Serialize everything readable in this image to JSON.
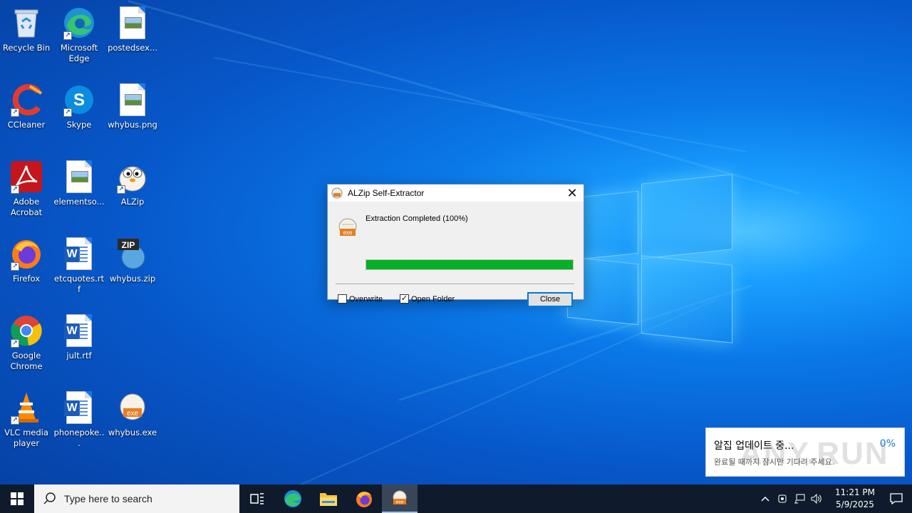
{
  "desktop": {
    "icons": [
      {
        "label": "Recycle Bin"
      },
      {
        "label": "Microsoft Edge"
      },
      {
        "label": "postedsex..."
      },
      {
        "label": "CCleaner"
      },
      {
        "label": "Skype"
      },
      {
        "label": "whybus.png"
      },
      {
        "label": "Adobe Acrobat"
      },
      {
        "label": "elementso..."
      },
      {
        "label": "ALZip"
      },
      {
        "label": "Firefox"
      },
      {
        "label": "etcquotes.rtf"
      },
      {
        "label": "whybus.zip"
      },
      {
        "label": "Google Chrome"
      },
      {
        "label": "jult.rtf"
      },
      {
        "label": "VLC media player"
      },
      {
        "label": "phonepoke..."
      },
      {
        "label": "whybus.exe"
      }
    ]
  },
  "dialog": {
    "title": "ALZip Self-Extractor",
    "status": "Extraction Completed (100%)",
    "progress_percent": 100,
    "overwrite_label": "Overwrite",
    "overwrite_checked": false,
    "open_folder_label": "Open Folder",
    "open_folder_checked": true,
    "close_label": "Close",
    "icon_badge": "exe"
  },
  "notification": {
    "title": "알집 업데이트 중...",
    "subtitle": "완료될 때까지 잠시만 기다려 주세요.",
    "percent": "0%",
    "watermark": "ANY.RUN"
  },
  "taskbar": {
    "search_placeholder": "Type here to search",
    "time": "11:21 PM",
    "date": "5/9/2025",
    "pinned": [
      "task-view",
      "edge",
      "file-explorer",
      "firefox",
      "alzip-extractor"
    ]
  },
  "colors": {
    "progress_fill": "#06b025",
    "taskbar": "#0f1b2c",
    "accent": "#0078d7"
  }
}
